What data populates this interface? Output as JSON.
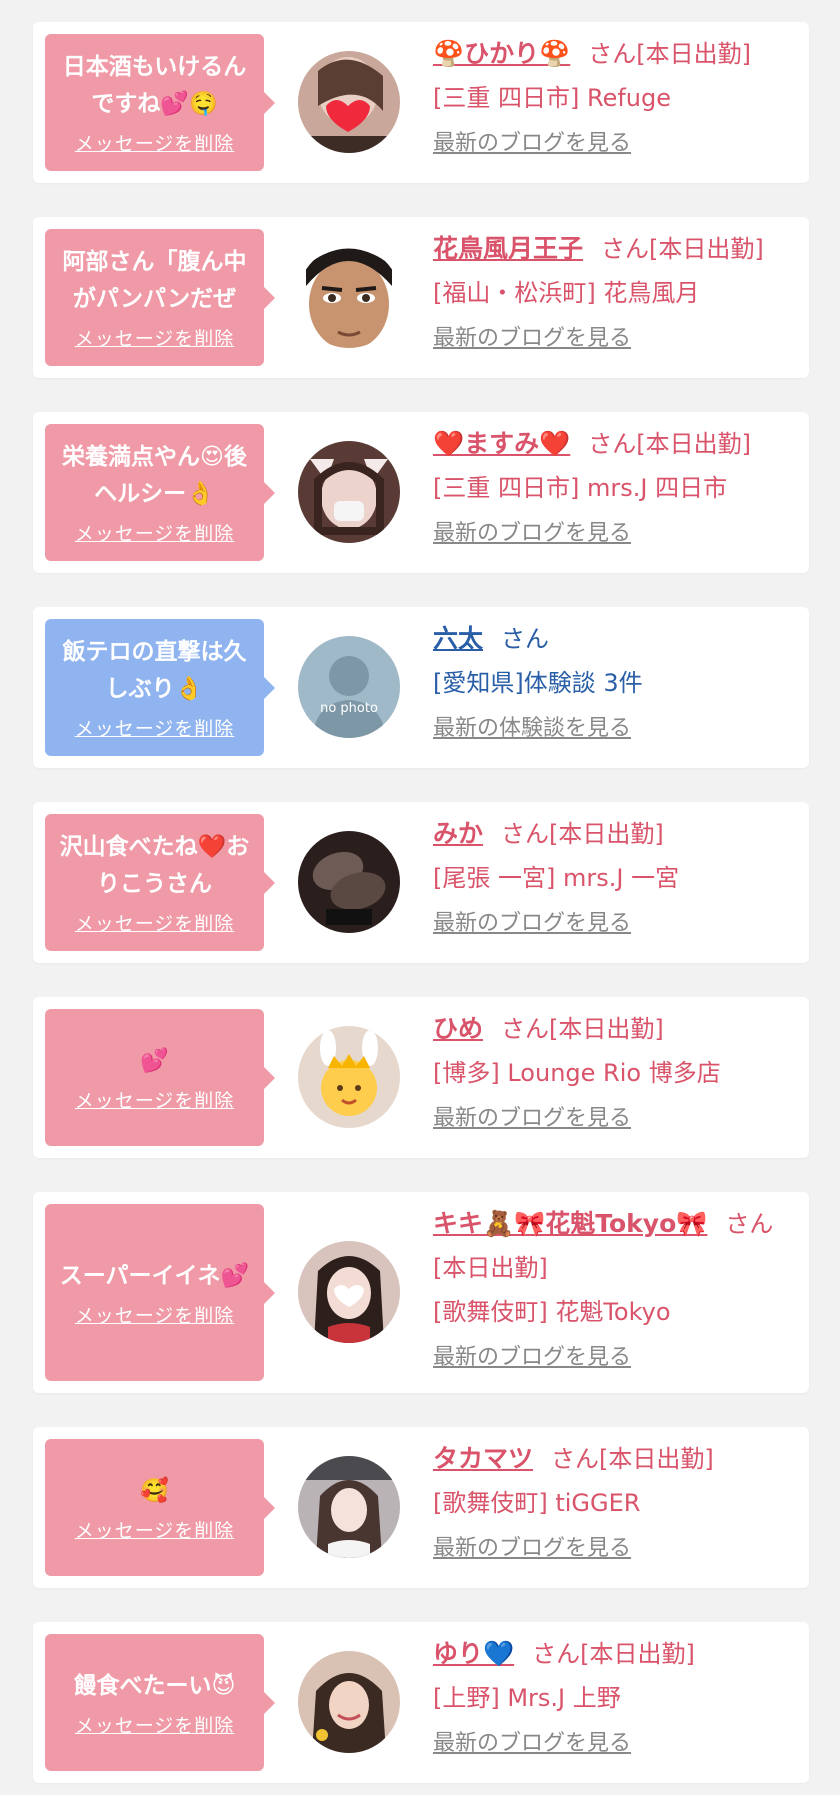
{
  "cards": [
    {
      "bubble_text": "日本酒もいけるん\nですね💕🤤",
      "delete_label": "メッセージを削除",
      "name": "🍄ひかり🍄",
      "suffix": "さん[本日出勤]",
      "location": "[三重 四日市] Refuge",
      "link": "最新のブログを見る",
      "bubble_color": "pink",
      "avatar": "woman-heart-photo"
    },
    {
      "bubble_text": "阿部さん「腹ん中\nがパンパンだぜ",
      "delete_label": "メッセージを削除",
      "name": "花鳥風月王子",
      "suffix": "さん[本日出勤]",
      "location": "[福山・松浜町] 花鳥風月",
      "link": "最新のブログを見る",
      "bubble_color": "pink",
      "avatar": "man-face-photo"
    },
    {
      "bubble_text": "栄養満点やん😍後\nヘルシー👌",
      "delete_label": "メッセージを削除",
      "name": "❤️ますみ❤️",
      "suffix": "さん[本日出勤]",
      "location": "[三重 四日市] mrs.J 四日市",
      "link": "最新のブログを見る",
      "bubble_color": "pink",
      "avatar": "woman-mask-photo"
    },
    {
      "bubble_text": "飯テロの直撃は久\nしぶり👌",
      "delete_label": "メッセージを削除",
      "name": "六太",
      "suffix": "さん",
      "location": "[愛知県]体験談 3件",
      "link": "最新の体験談を見る",
      "bubble_color": "blue",
      "avatar": "no-photo-placeholder",
      "avatar_text": "no photo"
    },
    {
      "bubble_text": "沢山食べたね❤️お\nりこうさん",
      "delete_label": "メッセージを削除",
      "name": "みか",
      "suffix": "さん[本日出勤]",
      "location": "[尾張 一宮] mrs.J 一宮",
      "link": "最新のブログを見る",
      "bubble_color": "pink",
      "avatar": "legs-photo"
    },
    {
      "bubble_text": "💕",
      "delete_label": "メッセージを削除",
      "name": "ひめ",
      "suffix": "さん[本日出勤]",
      "location": "[博多] Lounge Rio 博多店",
      "link": "最新のブログを見る",
      "bubble_color": "pink",
      "avatar": "princess-emoji-photo"
    },
    {
      "bubble_text": "スーパーイイネ💕",
      "delete_label": "メッセージを削除",
      "name": "キキ🧸🎀花魁Tokyo🎀",
      "suffix": "さん[本日出勤]",
      "location": "[歌舞伎町] 花魁Tokyo",
      "link": "最新のブログを見る",
      "bubble_color": "pink",
      "avatar": "woman-heart-face-photo"
    },
    {
      "bubble_text": "🥰",
      "delete_label": "メッセージを削除",
      "name": "タカマツ",
      "suffix": "さん[本日出勤]",
      "location": "[歌舞伎町] tiGGER",
      "link": "最新のブログを見る",
      "bubble_color": "pink",
      "avatar": "woman-portrait-photo"
    },
    {
      "bubble_text": "饅食べたーい😈",
      "delete_label": "メッセージを削除",
      "name": "ゆり💙",
      "suffix": "さん[本日出勤]",
      "location": "[上野] Mrs.J 上野",
      "link": "最新のブログを見る",
      "bubble_color": "pink",
      "avatar": "woman-smile-photo"
    }
  ],
  "colors": {
    "page_bg": "#f2f2f2",
    "pink_bubble": "#ef9aa6",
    "blue_bubble": "#8fb4f0",
    "pink_text": "#d9546a",
    "blue_text": "#2a5fa8",
    "link_gray": "#888888"
  }
}
